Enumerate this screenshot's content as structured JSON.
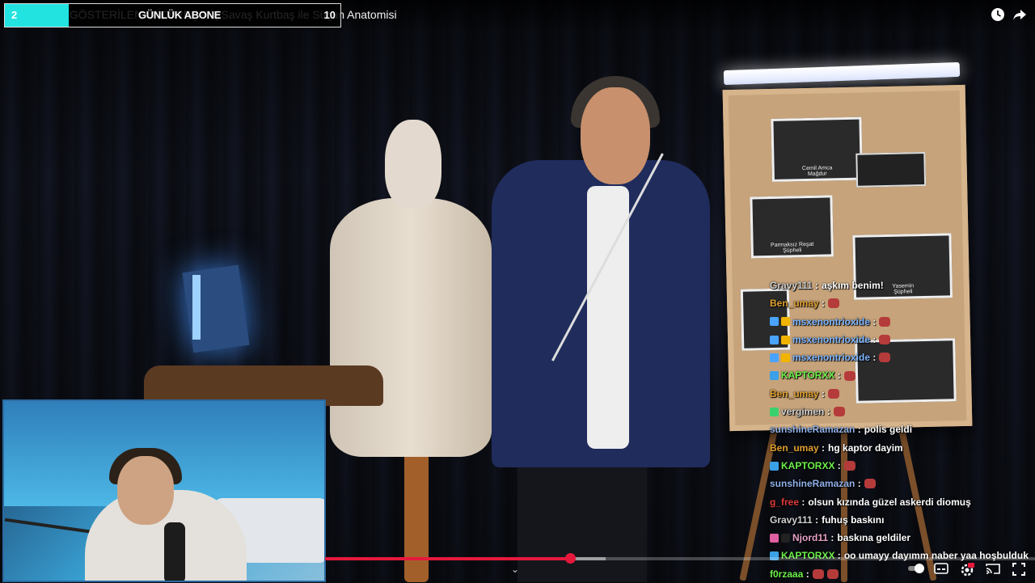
{
  "video": {
    "title": "GÖSTERİLEN GÜNLÜK ABONE İCİ REŞAT | Savaş Kurtbaş ile Suçun Anatomisi",
    "title_visible": "GÖSTERİLEN G            İCİ REŞAT | Savaş Kurtbaş ile Suçun Anatomisi",
    "progress_played": 0.345,
    "progress_buffered": 0.395
  },
  "sub_goal": {
    "current": "2",
    "label": "GÜNLÜK ABONE",
    "goal": "10",
    "fill_fraction": 0.19,
    "color": "#22e3e0"
  },
  "board": {
    "photo1_caption": "Cemil Amca",
    "photo1_sub": "Mağdur",
    "photo2_caption": "Parmaksız Reşat",
    "photo2_sub": "Şüpheli",
    "photo3_caption": "Yasemin",
    "photo3_sub": "Şüpheli"
  },
  "chat": [
    {
      "user": "Gravy111",
      "color": "#d0d0d0",
      "badges": [],
      "text": "aşkım benim!",
      "emotes": 0
    },
    {
      "user": "Ben_umay",
      "color": "#e0a030",
      "badges": [],
      "text": "",
      "emotes": 1
    },
    {
      "user": "msxenontrioxide",
      "color": "#7eb6ff",
      "badges": [
        "#4aa3ff",
        "#f0b400"
      ],
      "text": "",
      "emotes": 1
    },
    {
      "user": "msxenontrioxide",
      "color": "#7eb6ff",
      "badges": [
        "#4aa3ff",
        "#f0b400"
      ],
      "text": "",
      "emotes": 1
    },
    {
      "user": "msxenontrioxide",
      "color": "#7eb6ff",
      "badges": [
        "#4aa3ff",
        "#f0b400"
      ],
      "text": "",
      "emotes": 1
    },
    {
      "user": "KAPTORXX",
      "color": "#6cf04a",
      "badges": [
        "#3aa0e8"
      ],
      "text": "",
      "emotes": 1
    },
    {
      "user": "Ben_umay",
      "color": "#e0a030",
      "badges": [],
      "text": "",
      "emotes": 1
    },
    {
      "user": "vergimen",
      "color": "#d0d0d0",
      "badges": [
        "#3bd16f"
      ],
      "text": "",
      "emotes": 1
    },
    {
      "user": "sunshineRamazan",
      "color": "#8fb0e8",
      "badges": [],
      "text": "polis geldi",
      "emotes": 0
    },
    {
      "user": "Ben_umay",
      "color": "#e0a030",
      "badges": [],
      "text": "hg kaptor dayim",
      "emotes": 0
    },
    {
      "user": "KAPTORXX",
      "color": "#6cf04a",
      "badges": [
        "#3aa0e8"
      ],
      "text": "",
      "emotes": 1
    },
    {
      "user": "sunshineRamazan",
      "color": "#8fb0e8",
      "badges": [],
      "text": "",
      "emotes": 1
    },
    {
      "user": "g_free",
      "color": "#e03a3a",
      "badges": [],
      "text": "olsun kızında güzel askerdi diomuş",
      "emotes": 0
    },
    {
      "user": "Gravy111",
      "color": "#d0d0d0",
      "badges": [],
      "text": "fuhuş baskını",
      "emotes": 0
    },
    {
      "user": "Njord11",
      "color": "#e6a0c8",
      "badges": [
        "#e05fa0",
        "#222222"
      ],
      "text": "baskına geldiler",
      "emotes": 0
    },
    {
      "user": "KAPTORXX",
      "color": "#6cf04a",
      "badges": [
        "#3aa0e8"
      ],
      "text": "oo umayy dayımm naber yaa hoşbulduk",
      "emotes": 0
    },
    {
      "user": "f0rzaaa",
      "color": "#6cf04a",
      "badges": [],
      "text": "",
      "emotes": 2
    }
  ],
  "icons": {
    "watch_later": "clock-icon",
    "share": "share-icon",
    "chevron": "chevron-down-icon",
    "autoplay": "autoplay-toggle-icon",
    "subtitles": "subtitles-icon",
    "settings": "settings-icon",
    "cast": "cast-icon",
    "fullscreen": "fullscreen-icon"
  }
}
